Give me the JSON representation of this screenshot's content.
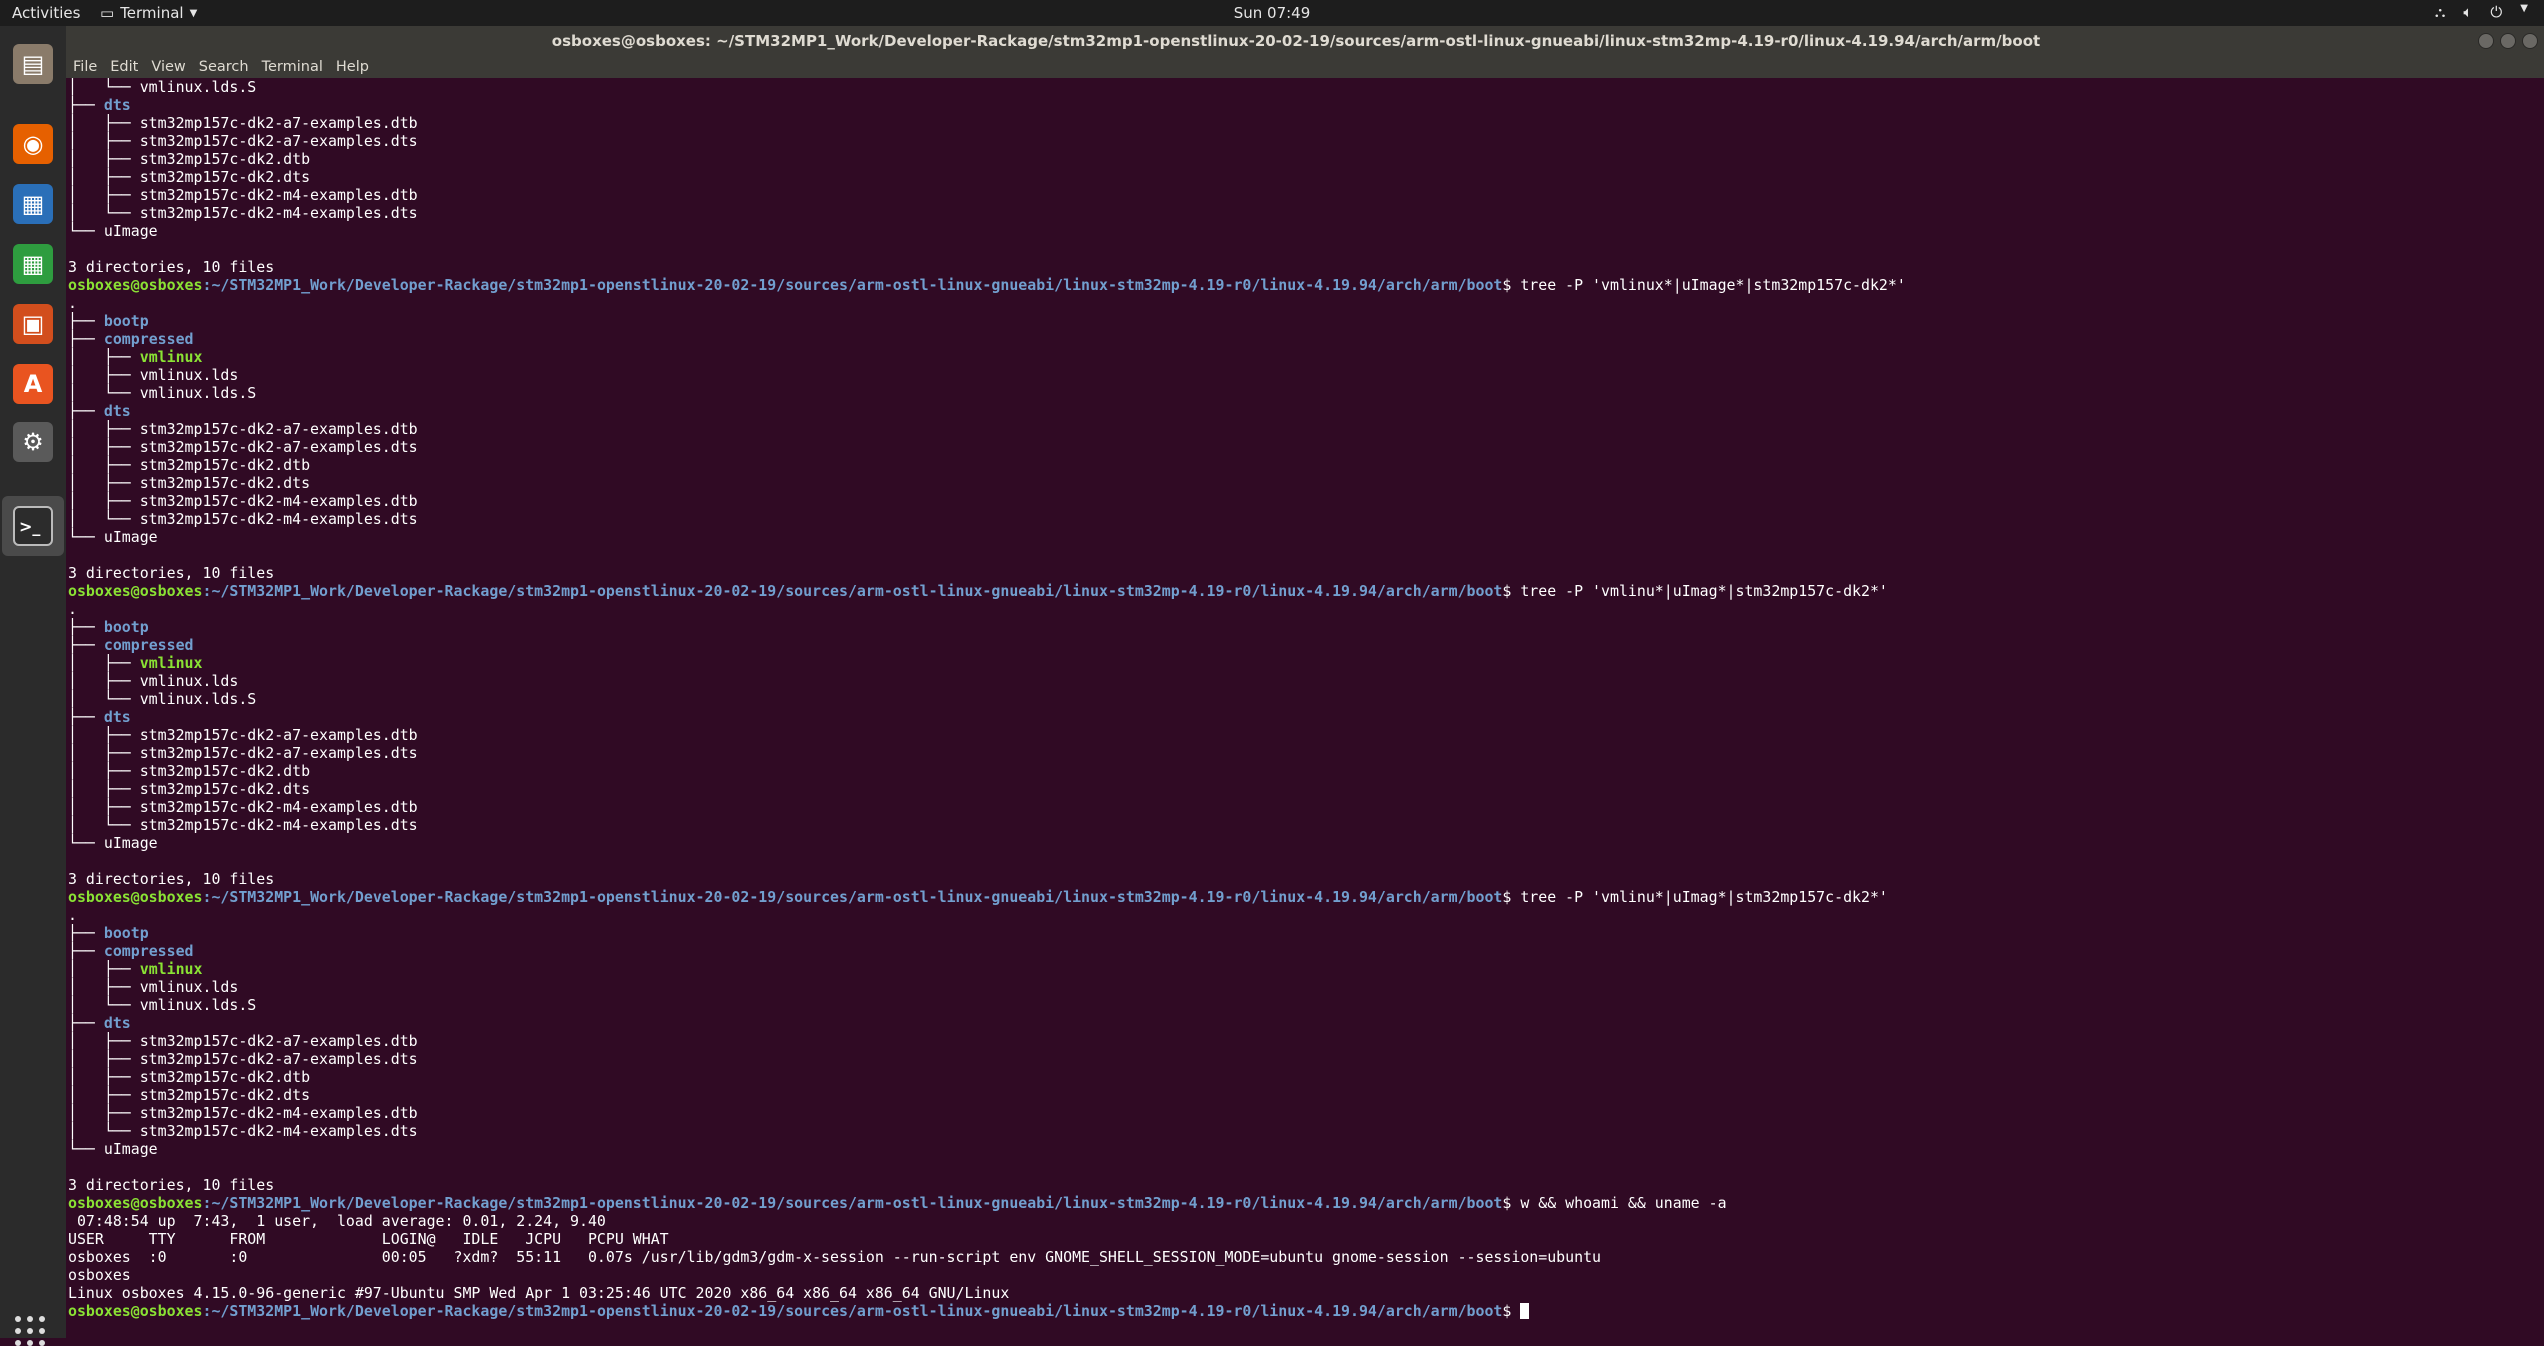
{
  "topbar": {
    "activities": "Activities",
    "app_menu": "Terminal",
    "clock": "Sun 07:49"
  },
  "window": {
    "title": "osboxes@osboxes: ~/STM32MP1_Work/Developer-Rackage/stm32mp1-openstlinux-20-02-19/sources/arm-ostl-linux-gnueabi/linux-stm32mp-4.19-r0/linux-4.19.94/arch/arm/boot"
  },
  "menu": [
    "File",
    "Edit",
    "View",
    "Search",
    "Terminal",
    "Help"
  ],
  "dock": [
    {
      "name": "files-icon",
      "color": "#8a7b6a"
    },
    {
      "name": "firefox-icon",
      "color": "#e66000"
    },
    {
      "name": "libreoffice-writer-icon",
      "color": "#2a6fb8"
    },
    {
      "name": "libreoffice-calc-icon",
      "color": "#2e9d3f"
    },
    {
      "name": "libreoffice-impress-icon",
      "color": "#d24e1d"
    },
    {
      "name": "software-center-icon",
      "color": "#e95420"
    },
    {
      "name": "system-settings-icon",
      "color": "#5a5a5a"
    },
    {
      "name": "terminal-icon",
      "color": "#2c2c2c"
    }
  ],
  "prompt": {
    "user": "osboxes@osboxes",
    "path": ":~/STM32MP1_Work/Developer-Rackage/stm32mp1-openstlinux-20-02-19/sources/arm-ostl-linux-gnueabi/linux-stm32mp-4.19-r0/linux-4.19.94/arch/arm/boot",
    "symbol": "$ "
  },
  "terminal_lines": [
    {
      "type": "plain",
      "text": "│   └── vmlinux.lds.S"
    },
    {
      "type": "dir",
      "prefix": "├── ",
      "name": "dts"
    },
    {
      "type": "plain",
      "text": "│   ├── stm32mp157c-dk2-a7-examples.dtb"
    },
    {
      "type": "plain",
      "text": "│   ├── stm32mp157c-dk2-a7-examples.dts"
    },
    {
      "type": "plain",
      "text": "│   ├── stm32mp157c-dk2.dtb"
    },
    {
      "type": "plain",
      "text": "│   ├── stm32mp157c-dk2.dts"
    },
    {
      "type": "plain",
      "text": "│   ├── stm32mp157c-dk2-m4-examples.dtb"
    },
    {
      "type": "plain",
      "text": "│   └── stm32mp157c-dk2-m4-examples.dts"
    },
    {
      "type": "plain",
      "text": "└── uImage"
    },
    {
      "type": "plain",
      "text": ""
    },
    {
      "type": "plain",
      "text": "3 directories, 10 files"
    },
    {
      "type": "prompt",
      "cmd": "tree -P 'vmlinux*|uImage*|stm32mp157c-dk2*'"
    },
    {
      "type": "plain",
      "text": "."
    },
    {
      "type": "dir",
      "prefix": "├── ",
      "name": "bootp"
    },
    {
      "type": "dir",
      "prefix": "├── ",
      "name": "compressed"
    },
    {
      "type": "exe",
      "prefix": "│   ├── ",
      "name": "vmlinux"
    },
    {
      "type": "plain",
      "text": "│   ├── vmlinux.lds"
    },
    {
      "type": "plain",
      "text": "│   └── vmlinux.lds.S"
    },
    {
      "type": "dir",
      "prefix": "├── ",
      "name": "dts"
    },
    {
      "type": "plain",
      "text": "│   ├── stm32mp157c-dk2-a7-examples.dtb"
    },
    {
      "type": "plain",
      "text": "│   ├── stm32mp157c-dk2-a7-examples.dts"
    },
    {
      "type": "plain",
      "text": "│   ├── stm32mp157c-dk2.dtb"
    },
    {
      "type": "plain",
      "text": "│   ├── stm32mp157c-dk2.dts"
    },
    {
      "type": "plain",
      "text": "│   ├── stm32mp157c-dk2-m4-examples.dtb"
    },
    {
      "type": "plain",
      "text": "│   └── stm32mp157c-dk2-m4-examples.dts"
    },
    {
      "type": "plain",
      "text": "└── uImage"
    },
    {
      "type": "plain",
      "text": ""
    },
    {
      "type": "plain",
      "text": "3 directories, 10 files"
    },
    {
      "type": "prompt",
      "cmd": "tree -P 'vmlinu*|uImag*|stm32mp157c-dk2*'"
    },
    {
      "type": "plain",
      "text": "."
    },
    {
      "type": "dir",
      "prefix": "├── ",
      "name": "bootp"
    },
    {
      "type": "dir",
      "prefix": "├── ",
      "name": "compressed"
    },
    {
      "type": "exe",
      "prefix": "│   ├── ",
      "name": "vmlinux"
    },
    {
      "type": "plain",
      "text": "│   ├── vmlinux.lds"
    },
    {
      "type": "plain",
      "text": "│   └── vmlinux.lds.S"
    },
    {
      "type": "dir",
      "prefix": "├── ",
      "name": "dts"
    },
    {
      "type": "plain",
      "text": "│   ├── stm32mp157c-dk2-a7-examples.dtb"
    },
    {
      "type": "plain",
      "text": "│   ├── stm32mp157c-dk2-a7-examples.dts"
    },
    {
      "type": "plain",
      "text": "│   ├── stm32mp157c-dk2.dtb"
    },
    {
      "type": "plain",
      "text": "│   ├── stm32mp157c-dk2.dts"
    },
    {
      "type": "plain",
      "text": "│   ├── stm32mp157c-dk2-m4-examples.dtb"
    },
    {
      "type": "plain",
      "text": "│   └── stm32mp157c-dk2-m4-examples.dts"
    },
    {
      "type": "plain",
      "text": "└── uImage"
    },
    {
      "type": "plain",
      "text": ""
    },
    {
      "type": "plain",
      "text": "3 directories, 10 files"
    },
    {
      "type": "prompt",
      "cmd": "tree -P 'vmlinu*|uImag*|stm32mp157c-dk2*'"
    },
    {
      "type": "plain",
      "text": "."
    },
    {
      "type": "dir",
      "prefix": "├── ",
      "name": "bootp"
    },
    {
      "type": "dir",
      "prefix": "├── ",
      "name": "compressed"
    },
    {
      "type": "exe",
      "prefix": "│   ├── ",
      "name": "vmlinux"
    },
    {
      "type": "plain",
      "text": "│   ├── vmlinux.lds"
    },
    {
      "type": "plain",
      "text": "│   └── vmlinux.lds.S"
    },
    {
      "type": "dir",
      "prefix": "├── ",
      "name": "dts"
    },
    {
      "type": "plain",
      "text": "│   ├── stm32mp157c-dk2-a7-examples.dtb"
    },
    {
      "type": "plain",
      "text": "│   ├── stm32mp157c-dk2-a7-examples.dts"
    },
    {
      "type": "plain",
      "text": "│   ├── stm32mp157c-dk2.dtb"
    },
    {
      "type": "plain",
      "text": "│   ├── stm32mp157c-dk2.dts"
    },
    {
      "type": "plain",
      "text": "│   ├── stm32mp157c-dk2-m4-examples.dtb"
    },
    {
      "type": "plain",
      "text": "│   └── stm32mp157c-dk2-m4-examples.dts"
    },
    {
      "type": "plain",
      "text": "└── uImage"
    },
    {
      "type": "plain",
      "text": ""
    },
    {
      "type": "plain",
      "text": "3 directories, 10 files"
    },
    {
      "type": "prompt",
      "cmd": "w && whoami && uname -a"
    },
    {
      "type": "plain",
      "text": " 07:48:54 up  7:43,  1 user,  load average: 0.01, 2.24, 9.40"
    },
    {
      "type": "plain",
      "text": "USER     TTY      FROM             LOGIN@   IDLE   JCPU   PCPU WHAT"
    },
    {
      "type": "plain",
      "text": "osboxes  :0       :0               00:05   ?xdm?  55:11   0.07s /usr/lib/gdm3/gdm-x-session --run-script env GNOME_SHELL_SESSION_MODE=ubuntu gnome-session --session=ubuntu"
    },
    {
      "type": "plain",
      "text": "osboxes"
    },
    {
      "type": "plain",
      "text": "Linux osboxes 4.15.0-96-generic #97-Ubuntu SMP Wed Apr 1 03:25:46 UTC 2020 x86_64 x86_64 x86_64 GNU/Linux"
    },
    {
      "type": "prompt",
      "cmd": "",
      "cursor": true
    }
  ]
}
